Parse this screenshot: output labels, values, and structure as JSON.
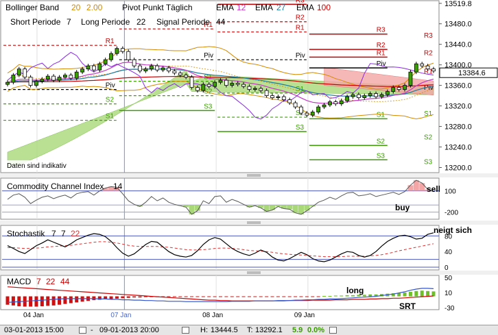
{
  "chart_data": {
    "type": "line",
    "instrument_last": "13384.6",
    "y_ticks": [
      "13519.8",
      "13480.0",
      "13440.0",
      "13400.0",
      "13360.0",
      "13320.0",
      "13280.0",
      "13240.0",
      "13200.0"
    ],
    "ylim": [
      13190,
      13525
    ],
    "x_ticks": [
      {
        "label": "04 Jan",
        "x": 0.08
      },
      {
        "label": "07 Jan",
        "x": 0.28,
        "highlight": true
      },
      {
        "label": "08 Jan",
        "x": 0.49
      },
      {
        "label": "09 Jan",
        "x": 0.7
      }
    ],
    "legend": {
      "line1": [
        {
          "text": "Bollinger Band",
          "color": "#000000"
        },
        {
          "text": "20",
          "color": "#d48a00"
        },
        {
          "text": "2.00",
          "color": "#d48a00"
        },
        {
          "text": "Pivot Punkt Täglich",
          "color": "#000000"
        },
        {
          "text": "EMA",
          "color": "#000000"
        },
        {
          "text": "12",
          "color": "#c23bc2"
        },
        {
          "text": "EMA",
          "color": "#000000"
        },
        {
          "text": "27",
          "color": "#1f7a9e"
        },
        {
          "text": "EMA",
          "color": "#000000"
        },
        {
          "text": "100",
          "color": "#cc0000"
        }
      ],
      "line2": [
        {
          "text": "Short Periode",
          "color": "#000000"
        },
        {
          "text": "7",
          "color": "#000000"
        },
        {
          "text": "Long Periode",
          "color": "#000000"
        },
        {
          "text": "22",
          "color": "#000000"
        },
        {
          "text": "Signal Periode",
          "color": "#000000"
        },
        {
          "text": "44",
          "color": "#000000"
        }
      ]
    },
    "note": "Daten sind indikativ",
    "close": [
      13366,
      13380,
      13392,
      13376,
      13360,
      13368,
      13372,
      13378,
      13370,
      13376,
      13380,
      13374,
      13386,
      13392,
      13398,
      13390,
      13402,
      13410,
      13422,
      13432,
      13426,
      13410,
      13398,
      13388,
      13392,
      13398,
      13390,
      13394,
      13388,
      13384,
      13380,
      13376,
      13356,
      13350,
      13362,
      13358,
      13366,
      13370,
      13360,
      13364,
      13362,
      13358,
      13352,
      13354,
      13350,
      13340,
      13336,
      13338,
      13332,
      13326,
      13318,
      13306,
      13302,
      13308,
      13318,
      13322,
      13328,
      13324,
      13330,
      13338,
      13342,
      13336,
      13340,
      13344,
      13338,
      13342,
      13348,
      13356,
      13352,
      13360,
      13386,
      13402,
      13398,
      13392,
      13388
    ],
    "pivot_days": [
      {
        "range": [
          0.0,
          0.265
        ],
        "R3": null,
        "R2": null,
        "R1": 13438,
        "Piv": 13352,
        "S1": 13292,
        "S2": 13324,
        "S3": null
      },
      {
        "range": [
          0.265,
          0.49
        ],
        "R3": null,
        "R2": null,
        "R1": 13470,
        "Piv": 13410,
        "S1": 13368,
        "S2": 13340,
        "S3": 13311
      },
      {
        "range": [
          0.49,
          0.7
        ],
        "R3": 13518,
        "R2": 13484,
        "R1": 13464,
        "Piv": 13410,
        "S1": 13345,
        "S2": 13298,
        "S3": 13270
      },
      {
        "range": [
          0.7,
          0.885
        ],
        "R3": 13460,
        "R2": 13430,
        "R1": 13415,
        "Piv": 13394,
        "S1": 13295,
        "S2": 13243,
        "S3": 13215
      }
    ],
    "levels_right": [
      {
        "label": "R3",
        "value": 13458,
        "color": "#cc0000"
      },
      {
        "label": "R2",
        "value": 13424,
        "color": "#cc0000"
      },
      {
        "label": "R1",
        "value": 13388,
        "color": "#cc0000"
      },
      {
        "label": "Piv",
        "value": 13357,
        "color": "#000000"
      },
      {
        "label": "S1",
        "value": 13306,
        "color": "#3aa000"
      },
      {
        "label": "S2",
        "value": 13260,
        "color": "#3aa000"
      },
      {
        "label": "S3",
        "value": 13212,
        "color": "#3aa000"
      }
    ],
    "cci": {
      "label": "Commodity Channel Index",
      "period": "14",
      "ticks": [
        "100",
        "-200"
      ],
      "annotations": [
        "sell",
        "buy"
      ],
      "values": [
        -20,
        40,
        60,
        10,
        -80,
        -30,
        10,
        30,
        -10,
        20,
        40,
        0,
        60,
        80,
        90,
        40,
        100,
        140,
        160,
        150,
        60,
        -40,
        -90,
        -120,
        -60,
        20,
        -40,
        0,
        -60,
        -90,
        -110,
        -130,
        -230,
        -180,
        -40,
        -80,
        20,
        30,
        -60,
        -20,
        -50,
        -90,
        -130,
        -110,
        -140,
        -190,
        -170,
        -120,
        -150,
        -160,
        -210,
        -230,
        -180,
        -120,
        -60,
        -30,
        10,
        -20,
        30,
        70,
        80,
        30,
        40,
        60,
        20,
        40,
        60,
        80,
        50,
        90,
        180,
        250,
        210,
        120,
        90
      ]
    },
    "stochastic": {
      "label": "Stochastik",
      "params": [
        "7",
        "7"
      ],
      "smooth": "22",
      "ticks": [
        "80",
        "40",
        "0"
      ],
      "annotation": "neigt sich",
      "k": [
        55,
        48,
        40,
        35,
        45,
        55,
        62,
        70,
        64,
        58,
        52,
        60,
        70,
        76,
        82,
        86,
        84,
        78,
        66,
        50,
        36,
        28,
        34,
        46,
        58,
        66,
        64,
        52,
        40,
        32,
        28,
        26,
        30,
        42,
        58,
        70,
        76,
        72,
        60,
        48,
        40,
        34,
        30,
        36,
        44,
        38,
        26,
        18,
        16,
        22,
        30,
        38,
        32,
        22,
        16,
        14,
        18,
        26,
        34,
        40,
        38,
        30,
        26,
        30,
        40,
        54,
        66,
        74,
        80,
        82,
        78,
        72,
        74,
        84,
        88
      ],
      "d": [
        50,
        50,
        49,
        48,
        48,
        49,
        50,
        52,
        53,
        54,
        55,
        56,
        58,
        60,
        62,
        64,
        65,
        65,
        64,
        62,
        59,
        56,
        54,
        53,
        53,
        53,
        53,
        52,
        51,
        49,
        47,
        45,
        44,
        44,
        45,
        46,
        48,
        49,
        49,
        48,
        47,
        45,
        43,
        42,
        41,
        40,
        38,
        36,
        34,
        33,
        32,
        31,
        30,
        29,
        28,
        27,
        27,
        27,
        27,
        28,
        28,
        28,
        28,
        29,
        30,
        32,
        35,
        38,
        42,
        45,
        48,
        51,
        54,
        57,
        60
      ]
    },
    "macd": {
      "label": "MACD",
      "params": [
        "7",
        "22",
        "44"
      ],
      "ticks": [
        "50",
        "10",
        "-30"
      ],
      "annotations": [
        "long",
        "SRT"
      ],
      "macd": [
        -16,
        -15,
        -14,
        -13,
        -12,
        -11,
        -10,
        -9,
        -8,
        -7,
        -6,
        -6,
        -6,
        -6,
        -6,
        -6,
        -7,
        -7,
        -8,
        -8,
        -9,
        -9,
        -10,
        -10,
        -11,
        -11,
        -12,
        -12,
        -13,
        -13,
        -13,
        -14,
        -14,
        -14,
        -14,
        -14,
        -14,
        -14,
        -14,
        -13,
        -13,
        -13,
        -13,
        -12,
        -12,
        -12,
        -12,
        -11,
        -11,
        -11,
        -10,
        -10,
        -9,
        -9,
        -8,
        -8,
        -7,
        -7,
        -6,
        -5,
        -4,
        -3,
        -2,
        -1,
        0,
        2,
        4,
        6,
        9,
        12,
        16,
        19,
        21,
        21,
        20
      ],
      "signal": [
        25,
        24,
        23,
        22,
        21,
        20,
        19,
        18,
        17,
        16,
        15,
        14,
        13,
        12,
        11,
        10,
        9,
        8,
        7,
        6,
        5,
        4,
        3,
        2,
        1,
        0,
        -1,
        -2,
        -3,
        -4,
        -5,
        -6,
        -7,
        -8,
        -9,
        -10,
        -10,
        -11,
        -11,
        -12,
        -12,
        -12,
        -12,
        -12,
        -12,
        -12,
        -12,
        -12,
        -12,
        -11,
        -11,
        -11,
        -11,
        -10,
        -10,
        -10,
        -10,
        -9,
        -9,
        -9,
        -8,
        -8,
        -8,
        -7,
        -7,
        -6,
        -6,
        -5,
        -5,
        -4,
        -3,
        -2,
        -1,
        0,
        1
      ],
      "hist": [
        -22,
        -24,
        -26,
        -27,
        -27,
        -27,
        -26,
        -25,
        -24,
        -22,
        -20,
        -18,
        -16,
        -14,
        -12,
        -10,
        -9,
        -8,
        -7,
        -6,
        -5,
        -4,
        -3,
        -3,
        -2,
        -2,
        -2,
        -1,
        -1,
        -1,
        -1,
        -1,
        -1,
        -1,
        -1,
        -1,
        -1,
        -1,
        -1,
        -1,
        -1,
        -1,
        -1,
        -1,
        -1,
        -1,
        -1,
        -1,
        -1,
        -1,
        -1,
        -1,
        -1,
        -1,
        -1,
        1,
        1,
        2,
        2,
        3,
        3,
        4,
        4,
        5,
        5,
        6,
        7,
        8,
        9,
        10,
        12,
        14,
        15,
        14,
        13
      ]
    }
  },
  "footer": {
    "from": "03-01-2013 15:00",
    "to": "09-01-2013 20:00",
    "high_label": "H:",
    "high": "13444.5",
    "low_label": "T:",
    "low": "13292.1",
    "change": "5.9",
    "change_pct": "0.0%"
  }
}
